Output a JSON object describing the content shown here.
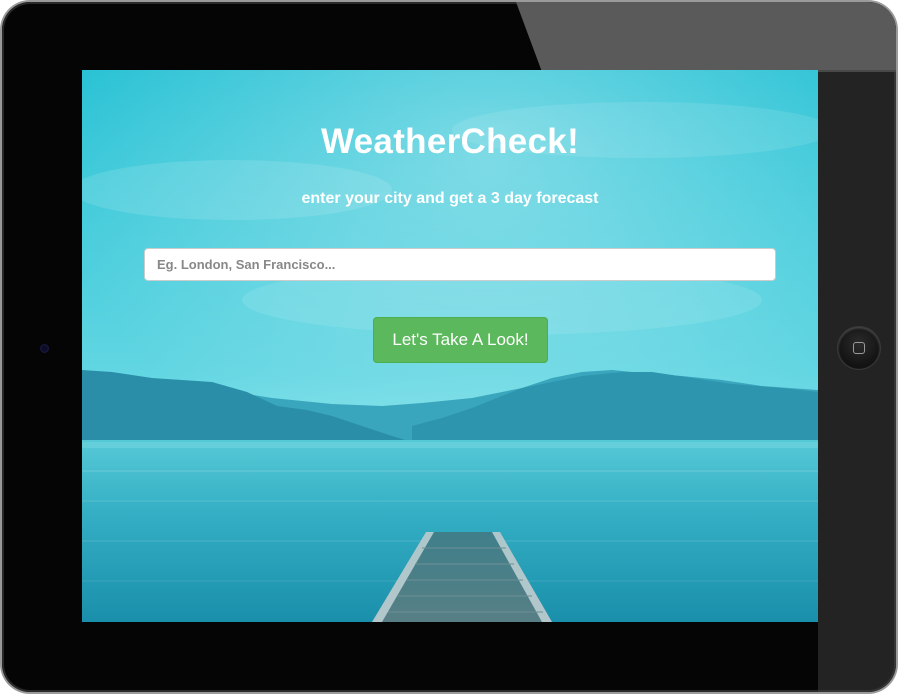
{
  "app": {
    "title": "WeatherCheck!",
    "subtitle": "enter your city and get a 3 day forecast"
  },
  "search": {
    "value": "",
    "placeholder": "Eg. London, San Francisco..."
  },
  "actions": {
    "submit_label": "Let's Take A Look!"
  },
  "colors": {
    "button": "#5cb85c",
    "sky": "#2cc4d6",
    "water": "#1c93ad",
    "bezel": "#050505"
  },
  "icons": {
    "home_button": "home-button-icon",
    "camera": "camera-icon"
  }
}
